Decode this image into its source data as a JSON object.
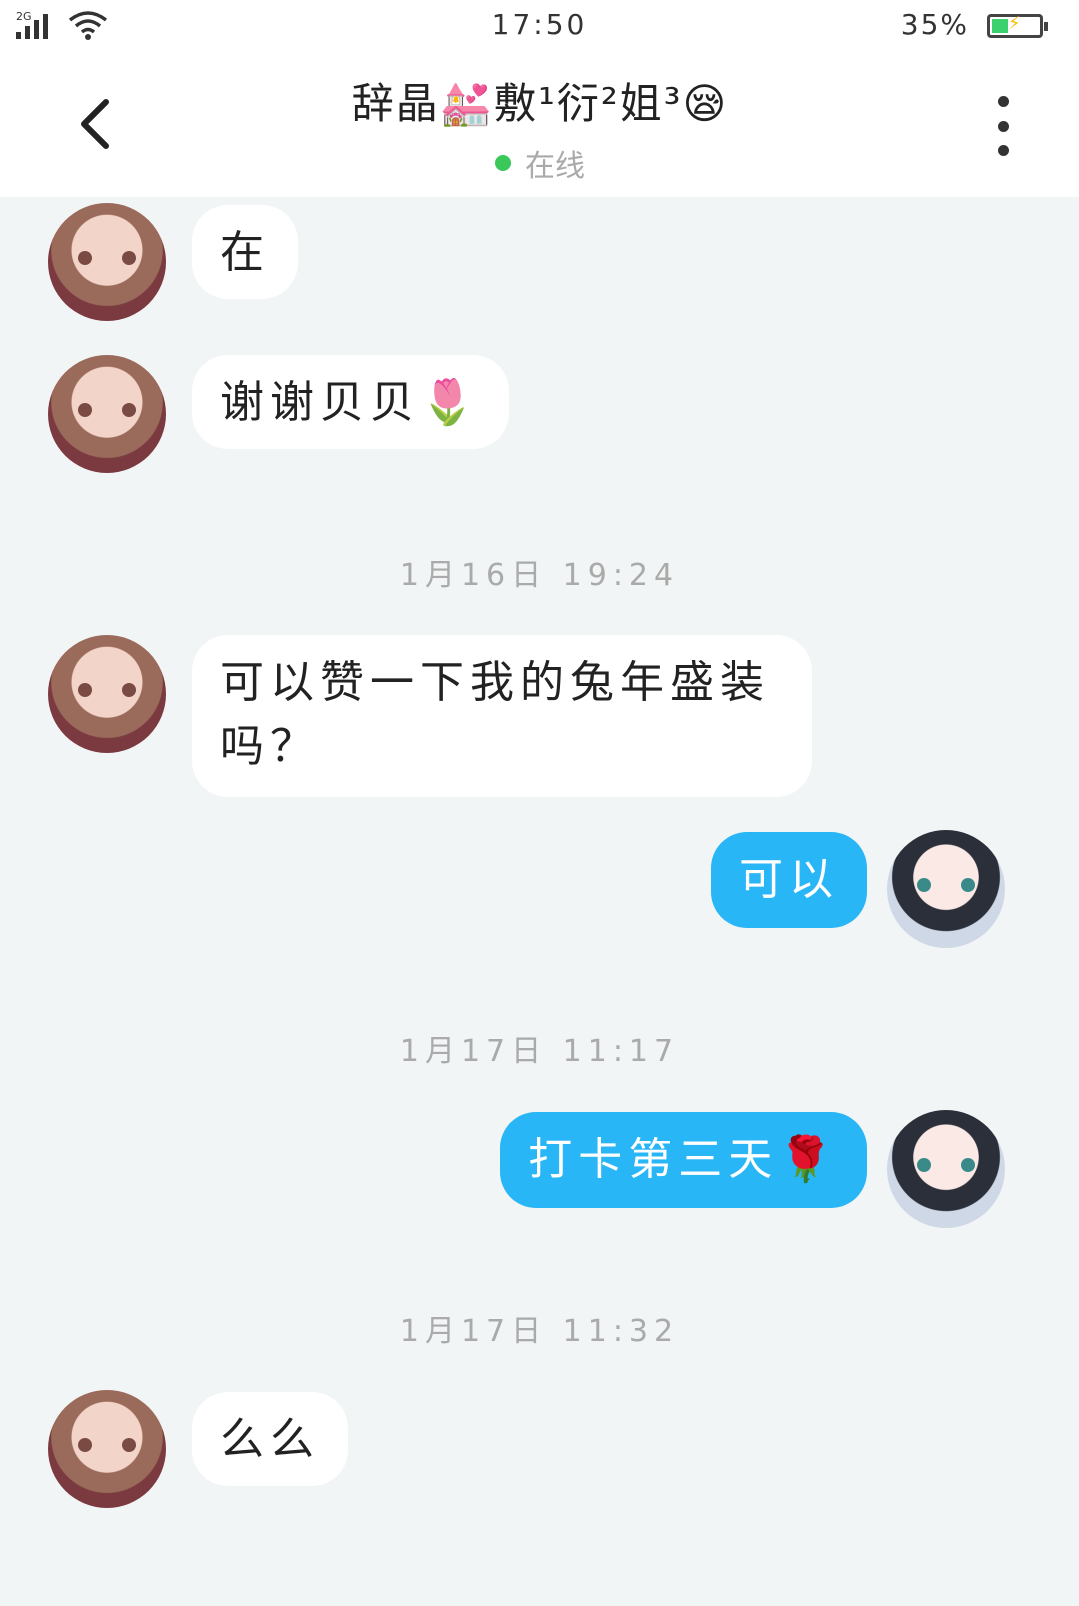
{
  "status_bar": {
    "network": "2G",
    "time": "17:50",
    "battery_text": "35%",
    "battery_level": 0.35,
    "icons": [
      "signal-icon",
      "wifi-icon",
      "battery-icon"
    ]
  },
  "header": {
    "back_icon": "chevron-left-icon",
    "title": "辞晶💒敷¹衍²姐³😪",
    "status": "在线",
    "status_color": "#3ac85a",
    "more_icon": "more-vertical-icon"
  },
  "messages": [
    {
      "side": "in",
      "text": "在"
    },
    {
      "side": "in",
      "text": "谢谢贝贝🌷"
    },
    {
      "type": "time",
      "text": "1月16日 19:24"
    },
    {
      "side": "in",
      "text": "可以赞一下我的兔年盛装吗？"
    },
    {
      "side": "out",
      "text": "可以"
    },
    {
      "type": "time",
      "text": "1月17日 11:17"
    },
    {
      "side": "out",
      "text": "打卡第三天🌹"
    },
    {
      "type": "time",
      "text": "1月17日 11:32"
    },
    {
      "side": "in",
      "text": "么么"
    }
  ],
  "colors": {
    "outgoing_bubble": "#29b6f6",
    "incoming_bubble": "#ffffff",
    "chat_background": "#f2f5f5"
  }
}
